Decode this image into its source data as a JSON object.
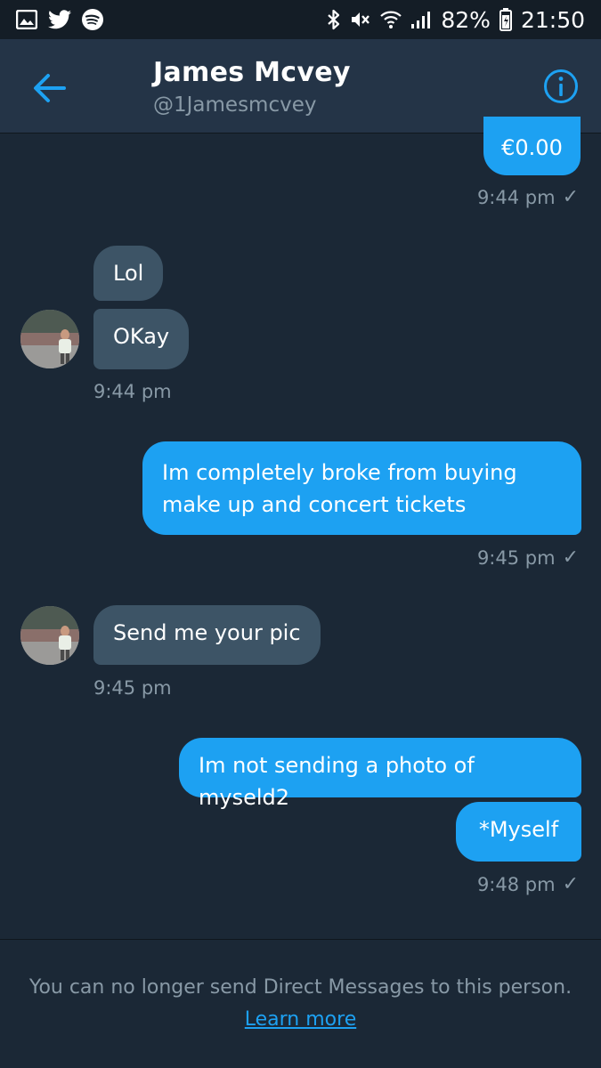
{
  "status_bar": {
    "battery": "82%",
    "time": "21:50",
    "icons_left": [
      "image-icon",
      "twitter-icon",
      "spotify-icon"
    ],
    "icons_right": [
      "bluetooth-icon",
      "mute-icon",
      "wifi-icon",
      "signal-icon",
      "battery-icon"
    ]
  },
  "header": {
    "name": "James Mcvey",
    "handle": "@1Jamesmcvey"
  },
  "messages": {
    "m1": {
      "text": "€0.00",
      "time": "9:44 pm"
    },
    "m2": {
      "text": "Lol"
    },
    "m3": {
      "text": "OKay",
      "time": "9:44 pm"
    },
    "m4": {
      "text": "Im completely broke from buying make up and concert tickets",
      "time": "9:45 pm"
    },
    "m5": {
      "text": "Send me your pic",
      "time": "9:45 pm"
    },
    "m6": {
      "text": "Im not sending a photo of myseld2"
    },
    "m7": {
      "text": "*Myself",
      "time": "9:48 pm"
    }
  },
  "footer": {
    "notice": "You can no longer send Direct Messages to this person.",
    "link": "Learn more"
  },
  "colors": {
    "background": "#1b2836",
    "header": "#243447",
    "accent": "#1da1f2",
    "incoming_bubble": "#3d5466",
    "muted": "#8899a6"
  }
}
